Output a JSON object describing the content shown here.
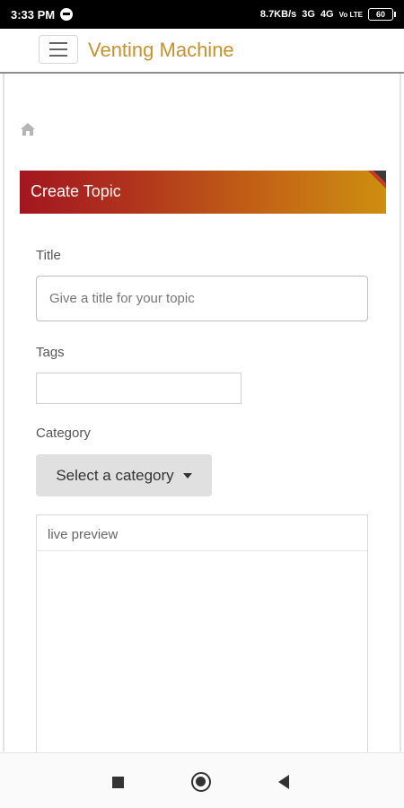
{
  "status_bar": {
    "time": "3:33 PM",
    "network_speed": "8.7KB/s",
    "signal_1": "3G",
    "signal_2": "4G",
    "volte": "Vo LTE",
    "battery": "60"
  },
  "app": {
    "title": "Venting Machine",
    "accent_color": "#c6922e"
  },
  "breadcrumb": {
    "icon": "home-icon"
  },
  "panel": {
    "heading": "Create Topic",
    "gradient_start": "#a3161f",
    "gradient_end": "#cd8f0f"
  },
  "form": {
    "title_label": "Title",
    "title_placeholder": "Give a title for your topic",
    "title_value": "",
    "tags_label": "Tags",
    "tags_value": "",
    "category_label": "Category",
    "category_button": "Select a category",
    "preview_label": "live preview"
  },
  "nav": {
    "recent_icon": "recent-apps-icon",
    "home_icon": "home-circle-icon",
    "back_icon": "back-icon"
  }
}
